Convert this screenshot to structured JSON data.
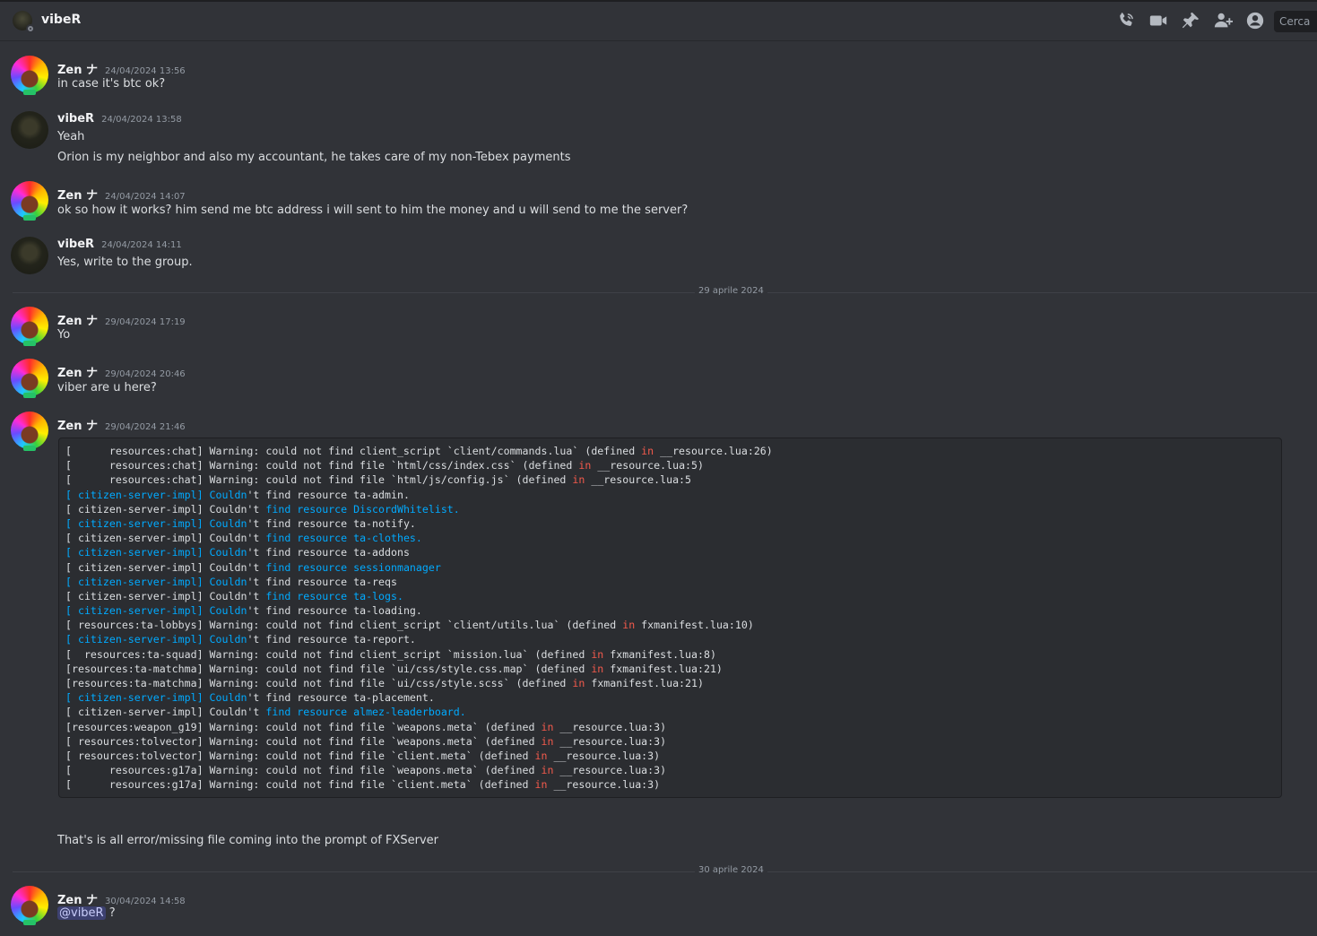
{
  "header": {
    "title": "vibeR",
    "search_placeholder": "Cerca"
  },
  "messages": [
    {
      "author": "Zen ナ",
      "time": "24/04/2024 13:56",
      "avatar": "zen",
      "lines": [
        "in case it's btc ok?"
      ]
    },
    {
      "author": "vibeR",
      "time": "24/04/2024 13:58",
      "avatar": "viber",
      "lines": [
        "Yeah",
        "Orion is my neighbor and also my accountant, he takes care of my non-Tebex payments"
      ]
    },
    {
      "author": "Zen ナ",
      "time": "24/04/2024 14:07",
      "avatar": "zen",
      "lines": [
        "ok so how it works? him send me btc address i will sent to him the money and u will send to me the server?"
      ]
    },
    {
      "author": "vibeR",
      "time": "24/04/2024 14:11",
      "avatar": "viber",
      "lines": [
        "Yes, write to the group."
      ]
    },
    {
      "author": "Zen ナ",
      "time": "29/04/2024 17:19",
      "avatar": "zen",
      "lines": [
        "Yo"
      ]
    },
    {
      "author": "Zen ナ",
      "time": "29/04/2024 20:46",
      "avatar": "zen",
      "lines": [
        "viber are u here?"
      ]
    },
    {
      "author": "Zen ナ",
      "time": "29/04/2024 21:46",
      "avatar": "zen",
      "lines": [
        "That's is all error/missing file coming into the prompt of FXServer"
      ]
    },
    {
      "author": "Zen ナ",
      "time": "30/04/2024 14:58",
      "avatar": "zen",
      "mention": "@vibeR",
      "after_mention": " ?"
    }
  ],
  "dividers": [
    "29 aprile 2024",
    "30 aprile 2024"
  ],
  "code_lines": [
    "[      resources:chat] Warning: could not find client_script `client/commands.lua` (defined in __resource.lua:26)",
    "[      resources:chat] Warning: could not find file `html/css/index.css` (defined in __resource.lua:5)",
    "[      resources:chat] Warning: could not find file `html/js/config.js` (defined in __resource.lua:5",
    "[ citizen-server-impl] Couldn't find resource ta-admin.",
    "[ citizen-server-impl] Couldn't find resource DiscordWhitelist.",
    "[ citizen-server-impl] Couldn't find resource ta-notify.",
    "[ citizen-server-impl] Couldn't find resource ta-clothes.",
    "[ citizen-server-impl] Couldn't find resource ta-addons",
    "[ citizen-server-impl] Couldn't find resource sessionmanager",
    "[ citizen-server-impl] Couldn't find resource ta-reqs",
    "[ citizen-server-impl] Couldn't find resource ta-logs.",
    "[ citizen-server-impl] Couldn't find resource ta-loading.",
    "[ resources:ta-lobbys] Warning: could not find client_script `client/utils.lua` (defined in fxmanifest.lua:10)",
    "[ citizen-server-impl] Couldn't find resource ta-report.",
    "[  resources:ta-squad] Warning: could not find client_script `mission.lua` (defined in fxmanifest.lua:8)",
    "[resources:ta-matchma] Warning: could not find file `ui/css/style.css.map` (defined in fxmanifest.lua:21)",
    "[resources:ta-matchma] Warning: could not find file `ui/css/style.scss` (defined in fxmanifest.lua:21)",
    "[ citizen-server-impl] Couldn't find resource ta-placement.",
    "[ citizen-server-impl] Couldn't find resource almez-leaderboard.",
    "[resources:weapon_g19] Warning: could not find file `weapons.meta` (defined in __resource.lua:3)",
    "[ resources:tolvector] Warning: could not find file `weapons.meta` (defined in __resource.lua:3)",
    "[ resources:tolvector] Warning: could not find file `client.meta` (defined in __resource.lua:3)",
    "[      resources:g17a] Warning: could not find file `weapons.meta` (defined in __resource.lua:3)",
    "[      resources:g17a] Warning: could not find file `client.meta` (defined in __resource.lua:3)"
  ],
  "colors": {
    "background": "#313338",
    "code_bg": "#2b2d31",
    "keyword_blue": "#00aaff",
    "keyword_red": "#f35a4c"
  }
}
